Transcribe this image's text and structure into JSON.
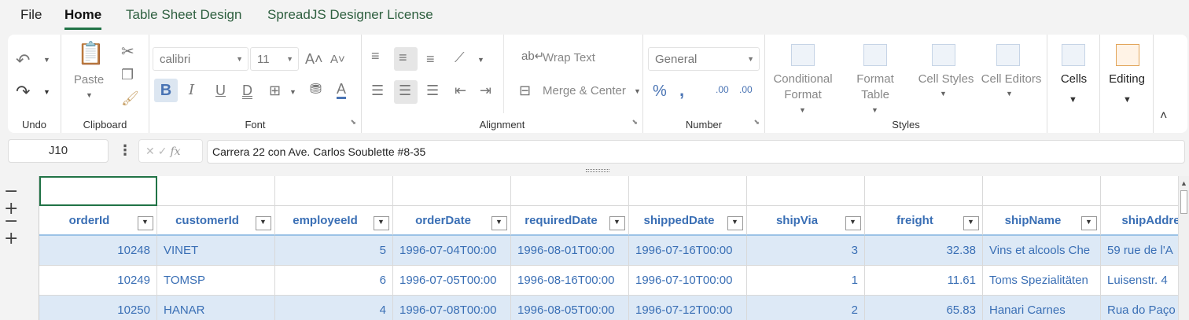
{
  "menu": {
    "file": "File",
    "home": "Home",
    "table_sheet_design": "Table Sheet Design",
    "license": "SpreadJS Designer License"
  },
  "ribbon": {
    "undo": {
      "label": "Undo"
    },
    "clipboard": {
      "label": "Clipboard",
      "paste": "Paste"
    },
    "font": {
      "label": "Font",
      "family": "calibri",
      "size": "11"
    },
    "alignment": {
      "label": "Alignment",
      "wrap_text": "Wrap Text",
      "merge_center": "Merge & Center"
    },
    "number": {
      "label": "Number",
      "format": "General"
    },
    "styles": {
      "label": "Styles",
      "conditional_format_1": "Conditional",
      "conditional_format_2": "Format",
      "format_table_1": "Format",
      "format_table_2": "Table",
      "cell_styles": "Cell Styles",
      "cell_editors": "Cell Editors"
    },
    "cells": "Cells",
    "editing": "Editing"
  },
  "formula_bar": {
    "name_box": "J10",
    "formula": "Carrera 22 con Ave. Carlos Soublette #8-35"
  },
  "grid": {
    "columns": [
      "orderId",
      "customerId",
      "employeeId",
      "orderDate",
      "requiredDate",
      "shippedDate",
      "shipVia",
      "freight",
      "shipName",
      "shipAddre"
    ],
    "rows": [
      [
        "10248",
        "VINET",
        "5",
        "1996-07-04T00:00",
        "1996-08-01T00:00",
        "1996-07-16T00:00",
        "3",
        "32.38",
        "Vins et alcools Che",
        "59 rue de l'A"
      ],
      [
        "10249",
        "TOMSP",
        "6",
        "1996-07-05T00:00",
        "1996-08-16T00:00",
        "1996-07-10T00:00",
        "1",
        "11.61",
        "Toms Spezialitäten",
        "Luisenstr. 4"
      ],
      [
        "10250",
        "HANAR",
        "4",
        "1996-07-08T00:00",
        "1996-08-05T00:00",
        "1996-07-12T00:00",
        "2",
        "65.83",
        "Hanari Carnes",
        "Rua do Paço"
      ]
    ]
  }
}
